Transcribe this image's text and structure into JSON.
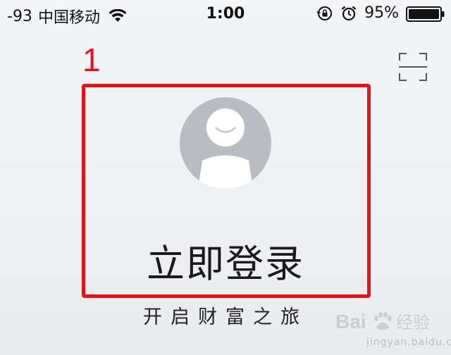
{
  "status_bar": {
    "signal": "-93",
    "carrier": "中国移动",
    "time": "1:00",
    "battery_percent": "95%",
    "icons": [
      "wifi-icon",
      "orientation-lock-icon",
      "alarm-icon",
      "battery-icon"
    ]
  },
  "annotation": {
    "number": "1",
    "color": "#e0141a"
  },
  "login": {
    "label": "立即登录"
  },
  "slogan": "开启财富之旅",
  "scan_icon": "scan-icon",
  "watermark": {
    "text": "Bai 经验",
    "sub": "jingyan.baidu.com"
  }
}
